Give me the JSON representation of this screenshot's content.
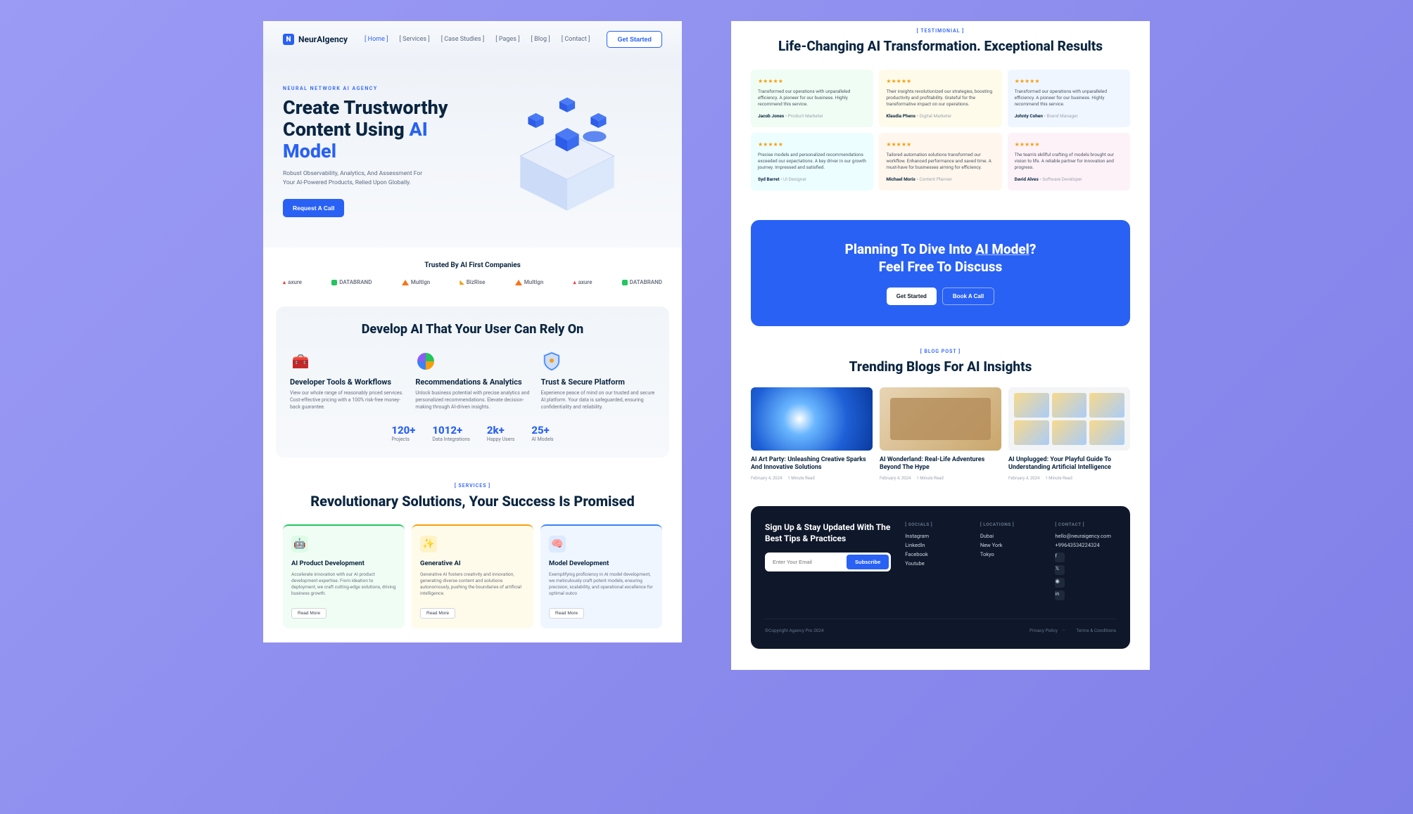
{
  "nav": {
    "brand": "NeurAIgency",
    "links": [
      "[ Home ]",
      "[ Services ]",
      "[ Case Studies ]",
      "[ Pages ]",
      "[ Blog ]",
      "[ Contact ]"
    ],
    "cta": "Get Started"
  },
  "hero": {
    "eyebrow": "NEURAL NETWORK AI AGENCY",
    "title_pre": "Create Trustworthy Content Using ",
    "title_accent": "AI Model",
    "sub": "Robust Observability, Analytics, And Assessment For Your AI-Powered Products, Relied Upon Globally.",
    "cta": "Request A Call"
  },
  "trusted": {
    "title": "Trusted By AI First Companies",
    "logos": [
      "axure",
      "DATABRAND",
      "MultIgn",
      "BizRise",
      "MultIgn",
      "axure",
      "DATABRAND"
    ]
  },
  "develop": {
    "title": "Develop AI That Your User Can Rely On",
    "cols": [
      {
        "icon": "dev-tools-icon",
        "title": "Developer Tools & Workflows",
        "text": "View our whole range of reasonably priced services. Cost-effective pricing with a 100% risk-free money-back guarantee."
      },
      {
        "icon": "analytics-icon",
        "title": "Recommendations & Analytics",
        "text": "Unlock business potential with precise analytics and personalized recommendations. Elevate decision-making through AI-driven insights."
      },
      {
        "icon": "shield-icon",
        "title": "Trust & Secure Platform",
        "text": "Experience peace of mind on our trusted and secure AI platform. Your data is safeguarded, ensuring confidentiality and reliability."
      }
    ],
    "stats": [
      {
        "val": "120+",
        "label": "Projects"
      },
      {
        "val": "1012+",
        "label": "Data Integrations"
      },
      {
        "val": "2k+",
        "label": "Happy Users"
      },
      {
        "val": "25+",
        "label": "AI Models"
      }
    ]
  },
  "services": {
    "eyebrow": "[ SERVICES ]",
    "title": "Revolutionary Solutions, Your Success Is Promised",
    "cards": [
      {
        "title": "AI Product Development",
        "text": "Accelerate innovation with our AI product development expertise. From ideation to deployment, we craft cutting-edge solutions, driving business growth.",
        "btn": "Read More"
      },
      {
        "title": "Generative AI",
        "text": "Generative AI fosters creativity and innovation, generating diverse content and solutions autonomously, pushing the boundaries of artificial intelligence.",
        "btn": "Read More"
      },
      {
        "title": "Model Development",
        "text": "Exemplifying proficiency in AI model development, we meticulously craft potent models, ensuring precision, scalability, and operational excellence for optimal outco",
        "btn": "Read More"
      }
    ]
  },
  "testimonials": {
    "eyebrow": "[ TESTIMONIAL ]",
    "title": "Life-Changing AI Transformation. Exceptional Results",
    "cards": [
      {
        "text": "Transformed our operations with unparalleled efficiency. A pioneer for our business. Highly recommend this service.",
        "name": "Jacob Jones",
        "role": "• Product Marketer"
      },
      {
        "text": "Their insights revolutionized our strategies, boosting productivity and profitability. Grateful for the transformative impact on our operations.",
        "name": "Klaudia Phens",
        "role": "• Digital Marketer"
      },
      {
        "text": "Transformed our operations with unparalleled efficiency. A pioneer for our business. Highly recommend this service.",
        "name": "Johnty Cohen",
        "role": "• Brand Manager"
      },
      {
        "text": "Precise models and personalized recommendations exceeded our expectations. A key driver in our growth journey. Impressed and satisfied.",
        "name": "Syd Barret",
        "role": "• UI Designer"
      },
      {
        "text": "Tailored automation solutions transformed our workflow. Enhanced performance and saved time. A must-have for businesses aiming for efficiency.",
        "name": "Michael Moris",
        "role": "• Content Planner"
      },
      {
        "text": "The team's skillful crafting of models brought our vision to life. A reliable partner for innovation and progress.",
        "name": "David Alves",
        "role": "• Software Developer"
      }
    ]
  },
  "cta": {
    "line1_pre": "Planning To Dive Into ",
    "line1_accent": "AI Model",
    "line1_post": "?",
    "line2": "Feel Free To Discuss",
    "btn1": "Get Started",
    "btn2": "Book A Call"
  },
  "blog": {
    "eyebrow": "[ BLOG POST ]",
    "title": "Trending Blogs For AI Insights",
    "posts": [
      {
        "title": "AI Art Party: Unleashing Creative Sparks And Innovative Solutions",
        "date": "February 4, 2024",
        "read": "1 Minute Read"
      },
      {
        "title": "AI Wonderland: Real-Life Adventures Beyond The Hype",
        "date": "February 4, 2024",
        "read": "1 Minute Read"
      },
      {
        "title": "AI Unplugged: Your Playful Guide To Understanding Artificial Intelligence",
        "date": "February 4, 2024",
        "read": "1 Minute Read"
      }
    ]
  },
  "footer": {
    "heading": "Sign Up & Stay Updated With The Best Tips & Practices",
    "placeholder": "Enter Your Email",
    "subscribe": "Subscribe",
    "socials_h": "[ SOCIALS ]",
    "socials": [
      "Instagram",
      "LinkedIn",
      "Facebook",
      "Youtube"
    ],
    "locations_h": "[ LOCATIONS ]",
    "locations": [
      "Dubai",
      "New York",
      "Tokyo"
    ],
    "contact_h": "[ CONTACT ]",
    "email": "hello@neuraigency.com",
    "phone": "+99643534224324",
    "copyright": "©Copyright Agency Pro 2024",
    "privacy": "Privacy Policy",
    "terms": "Terms & Conditions"
  }
}
